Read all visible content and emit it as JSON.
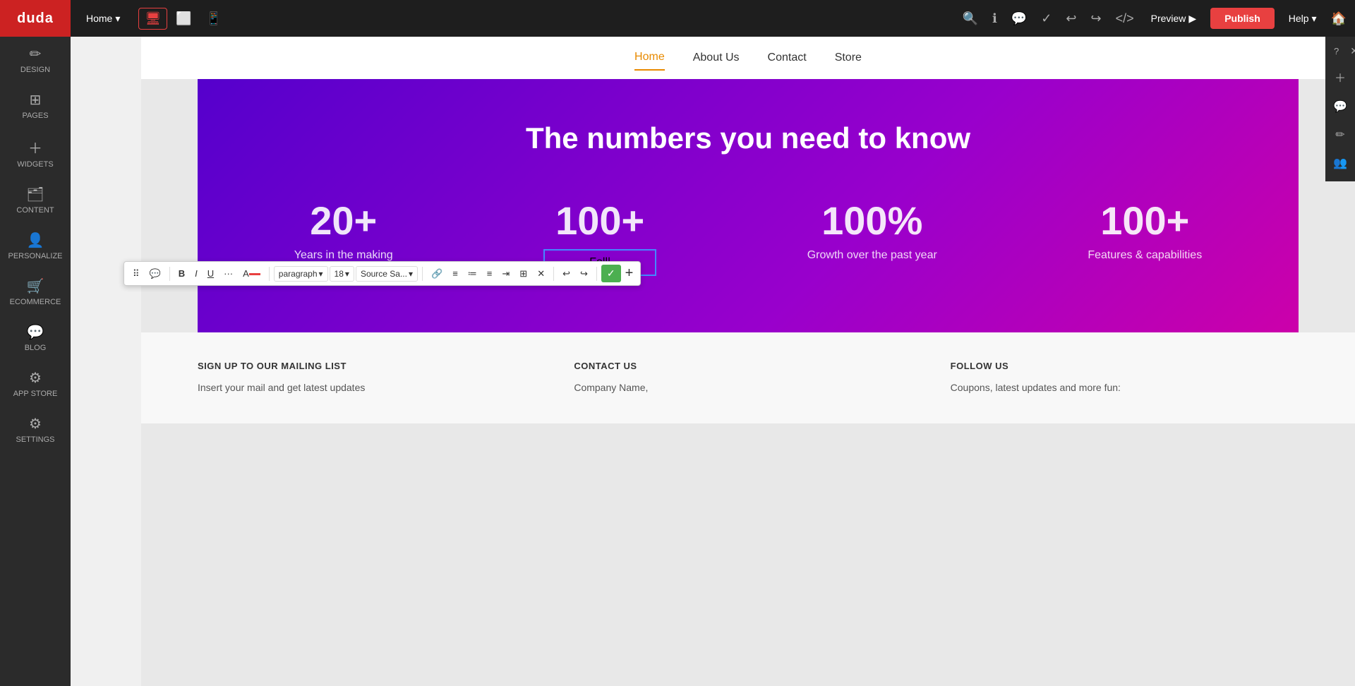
{
  "app": {
    "logo": "duda",
    "topbar": {
      "page_label": "Home",
      "preview_label": "Preview",
      "publish_label": "Publish",
      "help_label": "Help",
      "chevron": "▾",
      "play_icon": "▶"
    }
  },
  "sidebar": {
    "items": [
      {
        "id": "design",
        "icon": "✏️",
        "label": "DESIGN"
      },
      {
        "id": "pages",
        "icon": "⊞",
        "label": "PAGES"
      },
      {
        "id": "widgets",
        "icon": "+",
        "label": "WIDGETS"
      },
      {
        "id": "content",
        "icon": "🗂",
        "label": "CONTENT"
      },
      {
        "id": "personalize",
        "icon": "👤",
        "label": "PERSONALIZE"
      },
      {
        "id": "ecommerce",
        "icon": "🛒",
        "label": "ECOMMERCE"
      },
      {
        "id": "blog",
        "icon": "💬",
        "label": "BLOG"
      },
      {
        "id": "app_store",
        "icon": "⚙",
        "label": "APP STORE"
      },
      {
        "id": "settings",
        "icon": "⚙",
        "label": "SETTINGS"
      }
    ]
  },
  "site_nav": {
    "links": [
      {
        "label": "Home",
        "active": true
      },
      {
        "label": "About Us",
        "active": false
      },
      {
        "label": "Contact",
        "active": false
      },
      {
        "label": "Store",
        "active": false
      }
    ]
  },
  "hero": {
    "title": "The numbers you need to know",
    "stats": [
      {
        "number": "20+",
        "label": "Years in the making"
      },
      {
        "number": "100+",
        "label": "Foll"
      },
      {
        "number": "100%",
        "label": "Growth over the past year"
      },
      {
        "number": "100+",
        "label": "Features & capabilities"
      }
    ]
  },
  "toolbar": {
    "paragraph_label": "paragraph",
    "font_size": "18",
    "font_family": "Source Sa...",
    "confirm_icon": "✓",
    "plus_icon": "+"
  },
  "footer": {
    "cols": [
      {
        "title": "SIGN UP TO OUR MAILING LIST",
        "text": "Insert your mail and get latest updates"
      },
      {
        "title": "CONTACT US",
        "text": "Company Name,"
      },
      {
        "title": "FOLLOW US",
        "text": "Coupons, latest updates and more fun:"
      }
    ]
  },
  "right_panel": {
    "question_mark": "?",
    "close_icon": "✕"
  }
}
